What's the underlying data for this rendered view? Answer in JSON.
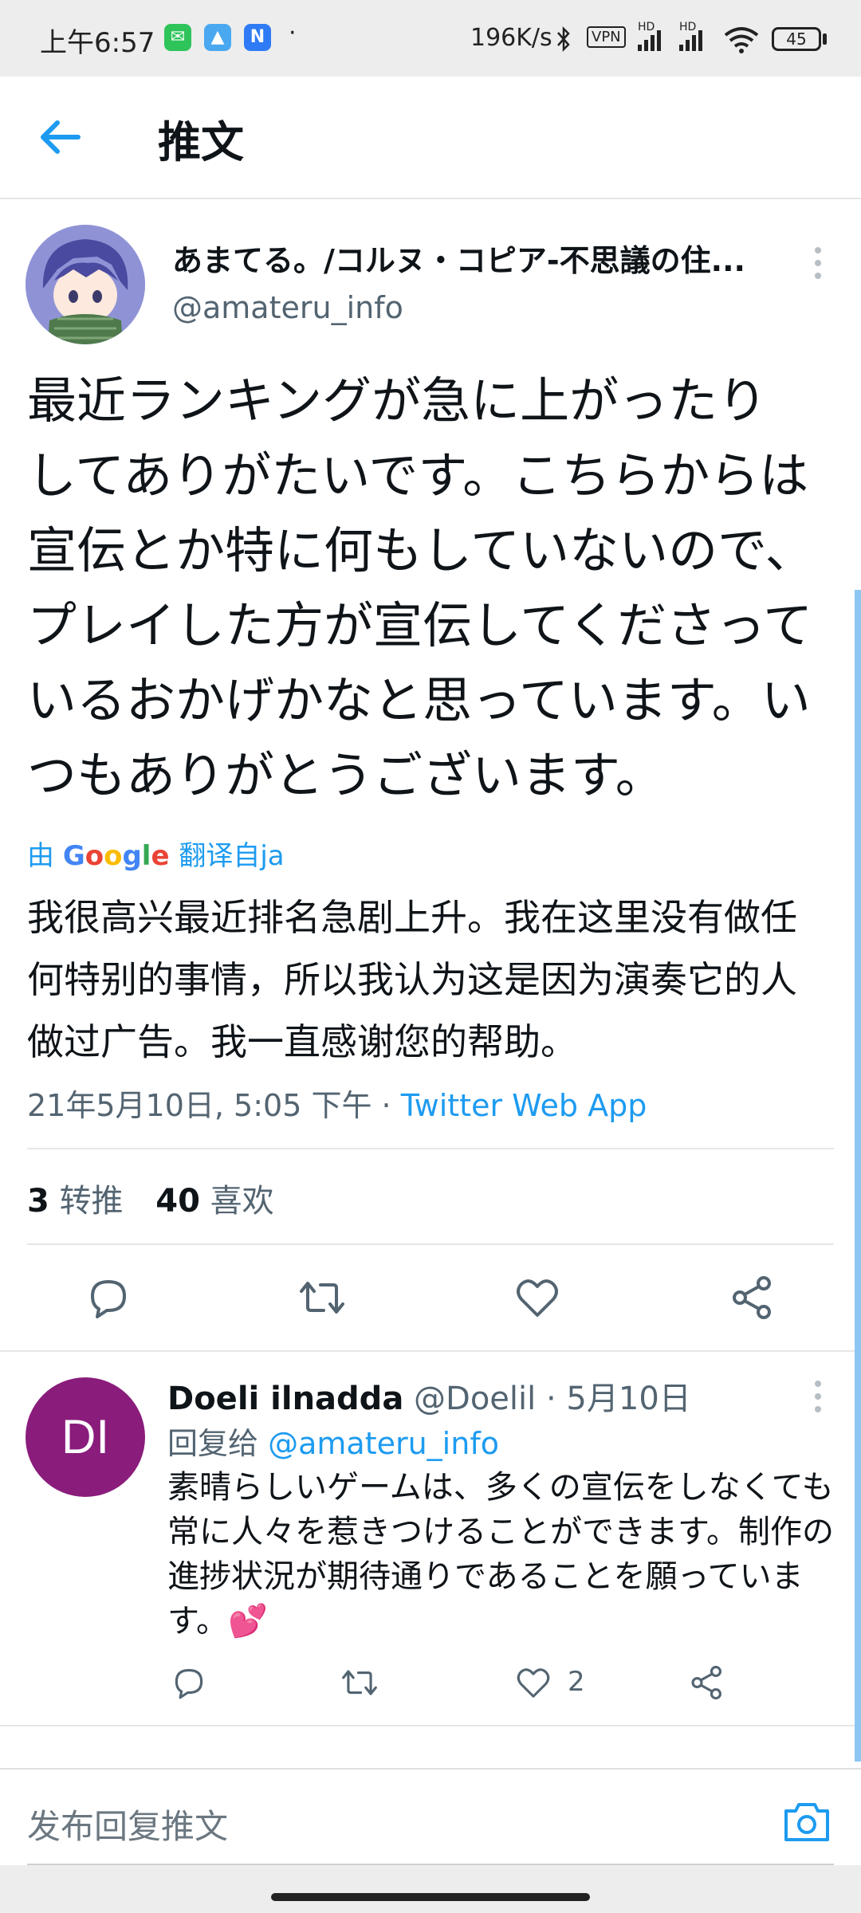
{
  "status_bar": {
    "time": "上午6:57",
    "dot": "·",
    "net_speed": "196K/s",
    "vpn": "VPN",
    "hd1": "HD",
    "hd2": "HD",
    "battery": "45"
  },
  "header": {
    "title": "推文"
  },
  "tweet": {
    "author_name": "あまてる。/コルヌ・コピア-不思議の住...",
    "author_handle": "@amateru_info",
    "text": "最近ランキングが急に上がったりしてありがたいです。こちらからは宣伝とか特に何もしていないので、プレイした方が宣伝してくださっているおかげかなと思っています。いつもありがとうございます。",
    "translated_prefix": "由",
    "translated_brand": "Google",
    "translated_suffix": "翻译自ja",
    "translation": "我很高兴最近排名急剧上升。我在这里没有做任何特别的事情，所以我认为这是因为演奏它的人做过广告。我一直感谢您的帮助。",
    "timestamp": "21年5月10日, 5:05 下午",
    "meta_sep": " · ",
    "source": "Twitter Web App",
    "retweets_count": "3",
    "retweets_label": "转推",
    "likes_count": "40",
    "likes_label": "喜欢"
  },
  "reply": {
    "avatar_initials": "DI",
    "name": "Doeli ilnadda",
    "handle": "@Doelil",
    "dot": " · ",
    "date": "5月10日",
    "reply_to_label": "回复给",
    "reply_to_handle": "@amateru_info",
    "text": "素晴らしいゲームは、多くの宣伝をしなくても常に人々を惹きつけることができます。制作の進捗状況が期待通りであることを願っています。💕",
    "like_count": "2"
  },
  "composer": {
    "placeholder": "发布回复推文"
  },
  "colors": {
    "accent": "#1d9bf0",
    "text": "#0f1419",
    "secondary": "#536471",
    "reply_avatar": "#8a1c7c"
  },
  "icons": [
    "back-arrow-icon",
    "more-icon",
    "reply-icon",
    "retweet-icon",
    "like-icon",
    "share-icon",
    "camera-icon"
  ]
}
